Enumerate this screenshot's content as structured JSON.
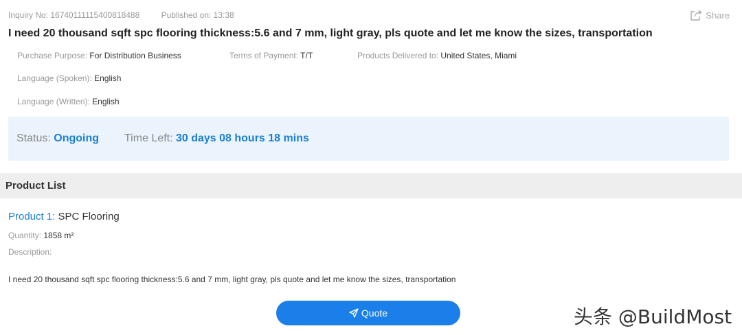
{
  "meta": {
    "inquiry_no": "Inquiry No: 16740111115400818488",
    "published": "Published on: 13:38",
    "share_label": "Share"
  },
  "title": "I need 20 thousand sqft spc flooring thickness:5.6 and 7 mm, light gray, pls quote and let me know the sizes, transportation",
  "attributes": {
    "purpose_label": "Purchase Purpose: ",
    "purpose_value": "For Distribution Business",
    "payment_label": "Terms of Payment: ",
    "payment_value": "T/T",
    "delivered_label": "Products Delivered to: ",
    "delivered_value": "United States, Miami",
    "lang_spoken_label": "Language (Spoken): ",
    "lang_spoken_value": "English",
    "lang_written_label": "Language (Written): ",
    "lang_written_value": "English"
  },
  "status": {
    "status_label": "Status: ",
    "status_value": "Ongoing",
    "time_label": "Time Left: ",
    "time_value": "30 days 08 hours 18 mins"
  },
  "product_list": {
    "heading": "Product List",
    "product_label": "Product 1: ",
    "product_name": "SPC Flooring",
    "quantity_label": "Quantity: ",
    "quantity_value": "1858 m²",
    "description_label": "Description:",
    "description_text": "I need 20 thousand sqft spc flooring thickness:5.6 and 7 mm, light gray, pls quote and let me know the sizes, transportation"
  },
  "actions": {
    "quote_label": "Quote"
  },
  "watermark": "头条 @BuildMost",
  "colors": {
    "accent": "#1a7fd4",
    "button": "#1a7fe8",
    "status_bg": "#ebf4fd",
    "section_bg": "#eeeeee"
  }
}
